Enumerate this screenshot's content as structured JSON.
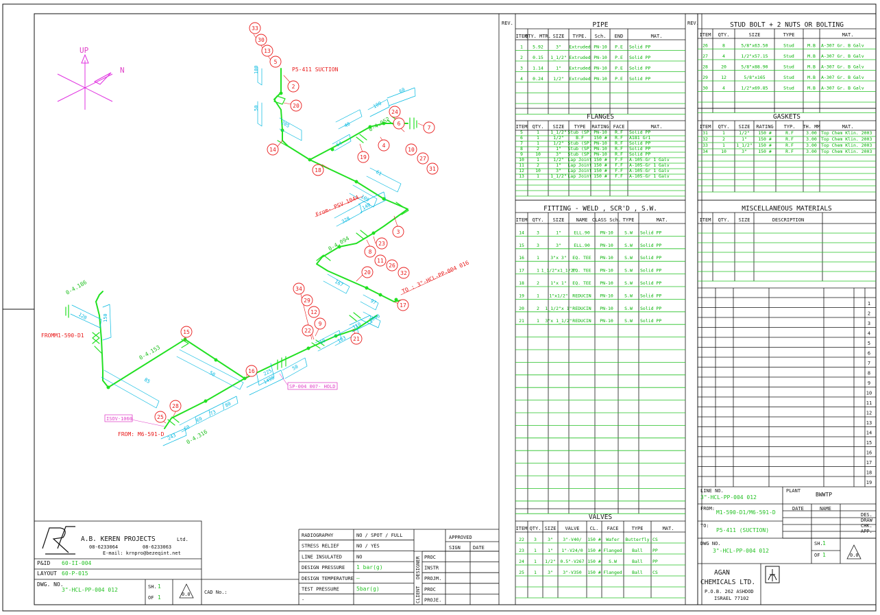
{
  "orientation": {
    "up": "UP",
    "north": "N"
  },
  "isometric": {
    "labels": [
      {
        "t": "P5-411 SUCTION",
        "k": "red"
      },
      {
        "t": "From- PSV 1044",
        "k": "red"
      },
      {
        "t": "TO : 3\"-HCL-PP-004 016",
        "k": "red"
      },
      {
        "t": "FROMM1-590-D1",
        "k": "red"
      },
      {
        "t": "FROM: M6-591-D",
        "k": "red"
      },
      {
        "t": "ISOV-1060",
        "k": "pink"
      },
      {
        "t": "SP-004 007- HOLD",
        "k": "pink"
      }
    ],
    "elevations": [
      "0-4.052",
      "0-4.186",
      "0-4.153",
      "0-4.094",
      "0-4.316"
    ],
    "dims": [
      "100",
      "50",
      "205",
      "40",
      "100",
      "60",
      "64",
      "61",
      "109",
      "328",
      "140",
      "167",
      "97",
      "85",
      "50",
      "2000",
      "1498",
      "50",
      "60",
      "103",
      "110",
      "120",
      "150",
      "243",
      "60",
      "69",
      "73",
      "80",
      "225"
    ],
    "bubbles": [
      "33",
      "30",
      "13",
      "5",
      "2",
      "20",
      "14",
      "18",
      "19",
      "4",
      "24",
      "6",
      "10",
      "27",
      "31",
      "7",
      "3",
      "8",
      "23",
      "11",
      "26",
      "32",
      "20",
      "17",
      "34",
      "29",
      "12",
      "9",
      "22",
      "21",
      "15",
      "16",
      "28",
      "25"
    ]
  },
  "titleblock": {
    "company": "A.B. KEREN PROJECTS",
    "ltd": "Ltd.",
    "tel": "08-6233064",
    "fax": "08-6233063",
    "email": "E-mail: krnpro@bezeqint.net",
    "pid_label": "P&ID",
    "pid_value": "60-II-004",
    "layout_label": "LAYOUT",
    "layout_value": "60-P-015",
    "dwg_label": "DWG. NO.",
    "dwg_value": "3\"-HCL-PP-004 012",
    "sh_label": "SH.",
    "sh_value": "1",
    "of_label": "OF",
    "of_value": "1",
    "rev_value": "0.0",
    "cad_label": "CAD No.:"
  },
  "testing": {
    "rows": [
      [
        "RADIOGRAPHY",
        "NO / SPOT / FULL"
      ],
      [
        "STRESS RELIEF",
        "NO / YES"
      ],
      [
        "LINE INSULATED",
        "NO"
      ],
      [
        "DESIGN PRESSURE",
        "1 bar(g)"
      ],
      [
        "DESIGN TEMPERATURE",
        "–"
      ],
      [
        "TEST PRESSURE",
        "5bar(g)"
      ],
      [
        "-",
        ""
      ]
    ],
    "approved": "APPROVED",
    "sign": "SIGN",
    "date": "DATE",
    "designer": "DESIGNER",
    "client": "CLIENT",
    "roles": [
      "PROC",
      "INSTR",
      "PROJM.",
      "PROC",
      "PROJE."
    ]
  },
  "rev": "REV.",
  "pipe": {
    "title": "PIPE",
    "headers": [
      "ITEM",
      "QTY. MTR.",
      "SIZE",
      "TYPE.",
      "Sch.",
      "END",
      "MAT."
    ],
    "rows": [
      [
        "1",
        "5.92",
        "3\"",
        "Extruded",
        "PN-10",
        "P.E",
        "Solid PP"
      ],
      [
        "2",
        "0.15",
        "1_1/2\"",
        "Extruded",
        "PN-10",
        "P.E",
        "Solid PP"
      ],
      [
        "3",
        "1.14",
        "1\"",
        "Extruded",
        "PN-10",
        "P.E",
        "Solid PP"
      ],
      [
        "4",
        "0.24",
        "1/2\"",
        "Extruded",
        "PN-10",
        "P.E",
        "Solid PP"
      ]
    ]
  },
  "flanges": {
    "title": "FLANGES",
    "headers": [
      "ITEM",
      "QTY.",
      "SIZE",
      "TYPE",
      "RATING",
      "FACE",
      "MAT."
    ],
    "rows": [
      [
        "5",
        "1",
        "1_1/2\"",
        "Stub (SP)",
        "PN-10",
        "R.F",
        "Solid PP"
      ],
      [
        "6",
        "1",
        "1/2\"",
        "B.F",
        "150 #",
        "R.F",
        "A181 Gr1"
      ],
      [
        "7",
        "1",
        "1/2\"",
        "Stub (SP)",
        "PN-10",
        "R.F",
        "Solid PP"
      ],
      [
        "8",
        "2",
        "1\"",
        "Stub (SP)",
        "PN-10",
        "R.F",
        "Solid PP"
      ],
      [
        "9",
        "10",
        "3\"",
        "Stub (SP)",
        "PN-10",
        "R.F",
        "Solid PP"
      ],
      [
        "10",
        "1",
        "1/2\"",
        "Lap Joint",
        "150 #",
        "F.F",
        "A-105-Gr 1 Galv"
      ],
      [
        "11",
        "2",
        "1\"",
        "Lap Joint",
        "150 #",
        "F.F",
        "A-105-Gr 1 Galv"
      ],
      [
        "12",
        "10",
        "3\"",
        "Lap Joint",
        "150 #",
        "F.F",
        "A-105-Gr 1 Galv"
      ],
      [
        "13",
        "1",
        "1_1/2\"",
        "Lap Joint",
        "150 #",
        "F.F",
        "A-105-Gr 1 Galv"
      ]
    ]
  },
  "fitting": {
    "title": "FITTING - WELD , SCR'D , S.W.",
    "headers": [
      "ITEM",
      "QTY.",
      "SIZE",
      "NAME",
      "CLASS Sch.",
      "TYPE",
      "MAT."
    ],
    "rows": [
      [
        "14",
        "3",
        "1\"",
        "ELL.90",
        "PN-10",
        "S.W",
        "Solid PP"
      ],
      [
        "15",
        "3",
        "3\"",
        "ELL.90",
        "PN-10",
        "S.W",
        "Solid PP"
      ],
      [
        "16",
        "1",
        "3\"x 3\"",
        "EQ. TEE",
        "PN-10",
        "S.W",
        "Solid PP"
      ],
      [
        "17",
        "1",
        "1_1/2\"x1_1/2\"",
        "EQ. TEE",
        "PN-10",
        "S.W",
        "Solid PP"
      ],
      [
        "18",
        "2",
        "1\"x 1\"",
        "EQ. TEE",
        "PN-10",
        "S.W",
        "Solid PP"
      ],
      [
        "19",
        "1",
        "1\"x1/2\"",
        "REDUCIN",
        "PN-10",
        "S.W",
        "Solid PP"
      ],
      [
        "20",
        "2",
        "1_1/2\"x 1\"",
        "REDUCIN",
        "PN-10",
        "S.W",
        "Solid PP"
      ],
      [
        "21",
        "1",
        "3\"x 1_1/2\"",
        "REDUCIN",
        "PN-10",
        "S.W",
        "Solid PP"
      ]
    ]
  },
  "valves": {
    "title": "VALVES",
    "headers": [
      "ITEM",
      "QTY.",
      "SIZE",
      "VALVE",
      "CL.",
      "FACE",
      "TYPE",
      "MAT."
    ],
    "rows": [
      [
        "22",
        "3",
        "3\"",
        "3\"-V40/",
        "150 #",
        "Wafer",
        "Butterfly",
        "CS"
      ],
      [
        "23",
        "1",
        "1\"",
        "1\"-V24/0",
        "150 #",
        "Flanged",
        "Ball",
        "PP"
      ],
      [
        "24",
        "1",
        "1/2\"",
        "0.5\"-V267",
        "150 #",
        "S.W",
        "Ball",
        "PP"
      ],
      [
        "25",
        "1",
        "3\"",
        "3\"-V350",
        "150 #",
        "Flanged",
        "Ball",
        "CS"
      ]
    ]
  },
  "stud": {
    "title": "STUD BOLT + 2 NUTS OR BOLTING",
    "headers": [
      "ITEM",
      "QTY.",
      "SIZE",
      "TYPE",
      "",
      "MAT."
    ],
    "rows": [
      [
        "26",
        "8",
        "5/8\"x63.50",
        "Stud",
        "M.B",
        "A-307 Gr. B Galv"
      ],
      [
        "27",
        "4",
        "1/2\"x57.15",
        "Stud",
        "M.B",
        "A-307 Gr. B Galv"
      ],
      [
        "28",
        "20",
        "5/8\"x88.90",
        "Stud",
        "M.B",
        "A-307 Gr. B Galv"
      ],
      [
        "29",
        "12",
        "5/8\"x165",
        "Stud",
        "M.B",
        "A-307 Gr. B Galv"
      ],
      [
        "30",
        "4",
        "1/2\"x69.85",
        "Stud",
        "M.B",
        "A-307 Gr. B Galv"
      ]
    ]
  },
  "gaskets": {
    "title": "GASKETS",
    "headers": [
      "ITEM",
      "QTY.",
      "SIZE",
      "RATING",
      "TYP.",
      "TH. MM",
      "MAT."
    ],
    "rows": [
      [
        "31",
        "1",
        "1/2\"",
        "150 #",
        "R.F",
        "3.00",
        "Top Chem Klin. 2003"
      ],
      [
        "32",
        "2",
        "1\"",
        "150 #",
        "R.F",
        "3.00",
        "Top Chem Klin. 2003"
      ],
      [
        "33",
        "1",
        "1_1/2\"",
        "150 #",
        "R.F",
        "3.00",
        "Top Chem Klin. 2003"
      ],
      [
        "34",
        "10",
        "3\"",
        "150 #",
        "R.F",
        "3.00",
        "Top Chem Klin. 2003"
      ]
    ]
  },
  "misc": {
    "title": "MISCELLANEOUS MATERIALS",
    "headers": [
      "ITEM",
      "QTY.",
      "SIZE",
      "DESCRIPTION"
    ]
  },
  "revnums": [
    "1",
    "2",
    "3",
    "4",
    "5",
    "6",
    "7",
    "8",
    "9",
    "10",
    "11",
    "12",
    "13",
    "14",
    "15",
    "16",
    "17",
    "18",
    "19"
  ],
  "rightblock": {
    "line_no_label": "LINE NO.",
    "line_no": "3\"-HCL-PP-004 012",
    "plant_label": "PLANT",
    "plant": "BWWTP",
    "from_label": "FROM:",
    "from": "M1-590-D1/M6-591-D",
    "to_label": "TO:",
    "to": "P5-411 (SUCTION)",
    "date": "DATE",
    "name": "NAME",
    "roles": [
      "DES.",
      "DRAW",
      "CHK.",
      "APP."
    ],
    "dwg_label": "DWG NO.",
    "dwg": "3\"-HCL-PP-004 012",
    "sh_label": "SH.",
    "sh": "1",
    "of_label": "OF",
    "of": "1",
    "rev": "0.0",
    "company1": "AGAN",
    "company2": "CHEMICALS LTD.",
    "addr1": "P.O.B. 262 ASHDOD",
    "addr2": "ISRAEL 77102"
  },
  "colors": {
    "pipe": "#22e022",
    "dim": "#00b8e0",
    "bubble": "#e81818",
    "compass": "#e030e0",
    "frame": "#111111"
  }
}
